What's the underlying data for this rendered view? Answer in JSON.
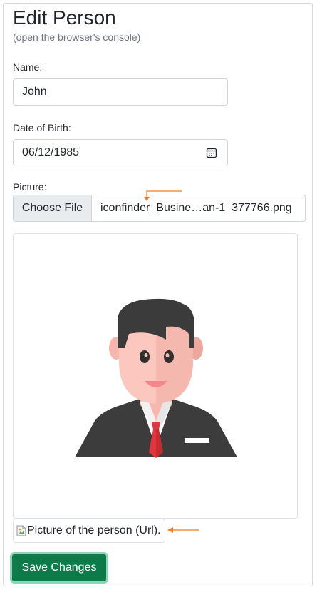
{
  "page": {
    "title": "Edit Person",
    "subtitle": "(open the browser's console)"
  },
  "form": {
    "name": {
      "label": "Name:",
      "value": "John"
    },
    "dob": {
      "label": "Date of Birth:",
      "value": "06/12/1985"
    },
    "picture": {
      "label": "Picture:",
      "choose_label": "Choose File",
      "file_name": "iconfinder_Busine…an-1_377766.png",
      "alt_text": "Picture of the person (Url)."
    },
    "save_label": "Save Changes"
  },
  "icons": {
    "calendar": "calendar-icon",
    "broken_image": "broken-image-icon",
    "annotation_arrow": "arrow-icon"
  },
  "colors": {
    "save_button": "#0d7a4a",
    "save_button_focus_ring": "#8fd4b6",
    "annotation": "#f07c1e"
  }
}
